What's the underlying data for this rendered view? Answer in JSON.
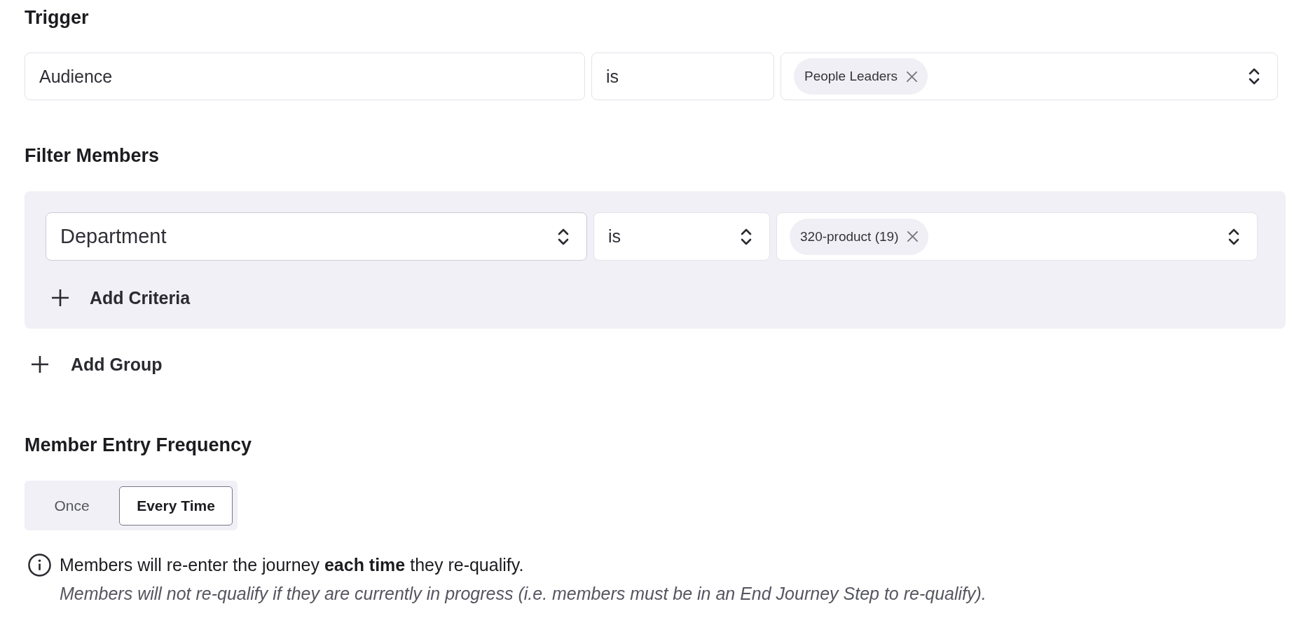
{
  "trigger": {
    "title": "Trigger",
    "fields": [
      {
        "kind": "input",
        "value": "Audience"
      },
      {
        "kind": "input",
        "value": "is"
      },
      {
        "kind": "select",
        "chips": [
          "People Leaders"
        ]
      }
    ]
  },
  "filter_members": {
    "title": "Filter Members",
    "groups": [
      {
        "criteria": [
          {
            "fields": [
              {
                "kind": "select",
                "value": "Department"
              },
              {
                "kind": "select",
                "value": "is"
              },
              {
                "kind": "select",
                "chips": [
                  "320-product (19)"
                ]
              }
            ]
          }
        ],
        "add_criteria": "Add Criteria"
      }
    ],
    "add_group": "Add Group"
  },
  "member_entry_frequency": {
    "title": "Member Entry Frequency",
    "options": [
      {
        "label": "Once",
        "selected": false
      },
      {
        "label": "Every Time",
        "selected": true
      }
    ],
    "info": "Members will re-enter the journey **each time** they re-qualify.",
    "note": "Members will not re-qualify if they are currently in progress (i.e. members must be in an End Journey Step to re-qualify)."
  }
}
